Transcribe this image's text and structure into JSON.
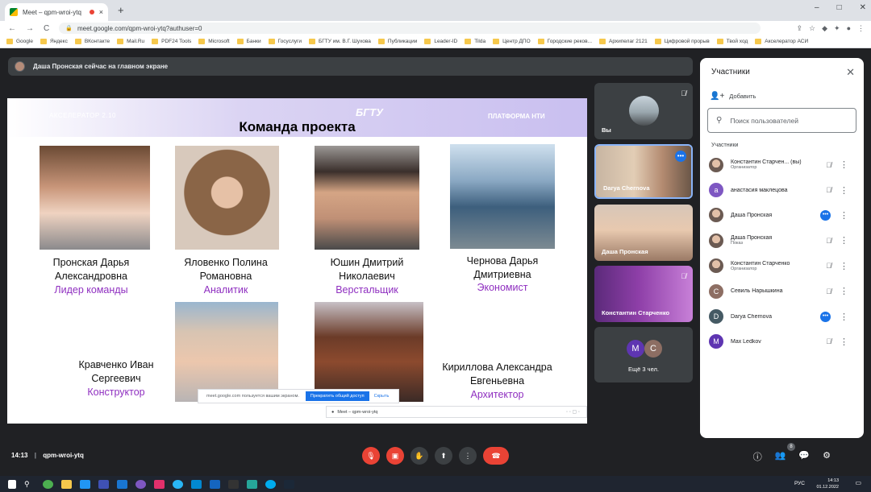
{
  "browser": {
    "tab_title": "Meet – qpm-wroi-ytq",
    "tab_close": "×",
    "new_tab": "+",
    "window_controls": [
      "–",
      "□",
      "✕"
    ],
    "nav": [
      "←",
      "→",
      "C"
    ],
    "url": "meet.google.com/qpm-wroi-ytq?authuser=0",
    "bookmarks": [
      "Google",
      "Яндекс",
      "ВКонтакте",
      "Mail.Ru",
      "PDF24 Tools",
      "Microsoft",
      "Банки",
      "Госуслуги",
      "БГТУ им. В.Г. Шухова",
      "Публикации",
      "Leader-ID",
      "Tilda",
      "Центр ДПО",
      "Городские реков...",
      "Архипелаг 2121",
      "Цифровой прорыв",
      "Твой ход",
      "Акселератор АСИ"
    ]
  },
  "presenting_banner": "Даша Пронская сейчас на главном экране",
  "slide": {
    "accelerator": "АКСЕЛЕРАТОР 2.10",
    "bgtu": "БГТУ",
    "platform": "ПЛАТФОРМА НТИ",
    "title": "Команда проекта",
    "members": [
      {
        "name1": "Пронская Дарья",
        "name2": "Александровна",
        "role": "Лидер команды"
      },
      {
        "name1": "Яловенко Полина",
        "name2": "Романовна",
        "role": "Аналитик"
      },
      {
        "name1": "Юшин Дмитрий",
        "name2": "Николаевич",
        "role": "Верстальщик"
      },
      {
        "name1": "Чернова Дарья",
        "name2": "Дмитриевна",
        "role": "Экономист"
      },
      {
        "name1": "Кравченко Иван",
        "name2": "Сергеевич",
        "role": "Конструктор"
      },
      {
        "name1": "Кириллова Александра",
        "name2": "Евгеньевна",
        "role": "Архитектор"
      }
    ],
    "share_notice": "meet.google.com пользуется вашим экраном.",
    "share_stop": "Прекратить общий доступ",
    "share_hide": "Скрыть",
    "minitab_title": "Meet – qpm-wroi-ytq"
  },
  "tiles": [
    {
      "name": "Вы"
    },
    {
      "name": "Darya Chernova"
    },
    {
      "name": "Даша Пронская"
    },
    {
      "name": "Константин Старченко"
    },
    {
      "name": "Ещё 3 чел.",
      "avatars": [
        "M",
        "C"
      ]
    }
  ],
  "panel": {
    "title": "Участники",
    "close": "✕",
    "add": "Добавить",
    "search_placeholder": "Поиск пользователей",
    "section": "Участники",
    "participants": [
      {
        "name": "Константин Старчен...  (вы)",
        "sub": "Организатор",
        "avatar": "",
        "color": "#5f6368",
        "img": true,
        "state": "mic-off"
      },
      {
        "name": "анастасия маклецова",
        "sub": "",
        "avatar": "а",
        "color": "#7e57c2",
        "img": false,
        "state": "mic-off"
      },
      {
        "name": "Даша Пронская",
        "sub": "",
        "avatar": "",
        "color": "#b58c79",
        "img": true,
        "state": "speaking"
      },
      {
        "name": "Даша Пронская",
        "sub": "Показ",
        "avatar": "",
        "color": "#b58c79",
        "img": true,
        "state": "mic-off"
      },
      {
        "name": "Константин Старченко",
        "sub": "Организатор",
        "avatar": "",
        "color": "#5f6368",
        "img": true,
        "state": "mic-off"
      },
      {
        "name": "Севиль Нарышкина",
        "sub": "",
        "avatar": "С",
        "color": "#8d6e63",
        "img": false,
        "state": "mic-off"
      },
      {
        "name": "Darya Chernova",
        "sub": "",
        "avatar": "D",
        "color": "#455a64",
        "img": false,
        "state": "speaking"
      },
      {
        "name": "Max Ledkov",
        "sub": "",
        "avatar": "M",
        "color": "#5e35b1",
        "img": false,
        "state": "mic-off"
      }
    ]
  },
  "bottom": {
    "time": "14:13",
    "separator": "|",
    "meeting_code": "qpm-wroi-ytq",
    "participants_count": "8"
  },
  "taskbar": {
    "lang": "РУС",
    "time": "14:13",
    "date": "01.12.2022"
  },
  "colors": {
    "accent": "#1a73e8",
    "danger": "#ea4335",
    "role_text": "#8f2fc0"
  }
}
